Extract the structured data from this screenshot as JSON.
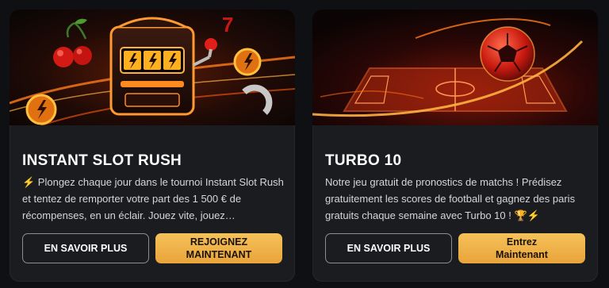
{
  "cards": [
    {
      "title": "INSTANT SLOT RUSH",
      "description": "⚡ Plongez chaque jour dans le tournoi Instant Slot Rush et tentez de remporter votre part des 1 500 € de récompenses, en un éclair. Jouez vite, jouez…",
      "learn_more": "EN SAVOIR PLUS",
      "cta_line1": "REJOIGNEZ",
      "cta_line2": "MAINTENANT",
      "banner_icon": "slot-machine-icon"
    },
    {
      "title": "TURBO 10",
      "description": "Notre jeu gratuit de pronostics de matchs ! Prédisez gratuitement les scores de football et gagnez des paris gratuits chaque semaine avec Turbo 10 ! 🏆⚡",
      "learn_more": "EN SAVOIR PLUS",
      "cta_line1": "Entrez",
      "cta_line2": "Maintenant",
      "banner_icon": "football-icon"
    }
  ],
  "colors": {
    "background": "#0f1013",
    "card": "#1b1c20",
    "gold": "#f0b34a",
    "accent_orange": "#ff7a1a"
  }
}
